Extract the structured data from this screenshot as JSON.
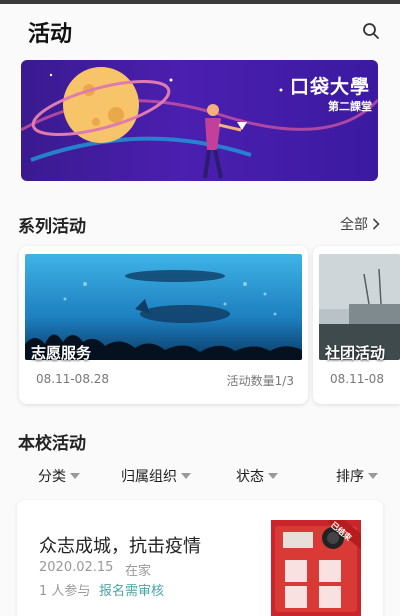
{
  "header": {
    "title": "活动",
    "search_icon": "search-icon"
  },
  "banner": {
    "title": "口袋大學",
    "subtitle": "第二課堂"
  },
  "series": {
    "heading": "系列活动",
    "all_label": "全部",
    "cards": [
      {
        "name": "志愿服务",
        "date": "08.11-08.28",
        "count": "活动数量1/3"
      },
      {
        "name": "社团活动",
        "date": "08.11-08"
      }
    ]
  },
  "campus": {
    "heading": "本校活动",
    "filters": [
      "分类",
      "归属组织",
      "状态",
      "排序"
    ]
  },
  "activity": {
    "title": "众志成城，抗击疫情",
    "date": "2020.02.15",
    "location": "在家",
    "participants": "1 人参与",
    "tag": "报名需审核",
    "badge": "已结束"
  },
  "colors": {
    "accent": "#4aa3a6",
    "banner_bg": "#4b1fb0"
  }
}
